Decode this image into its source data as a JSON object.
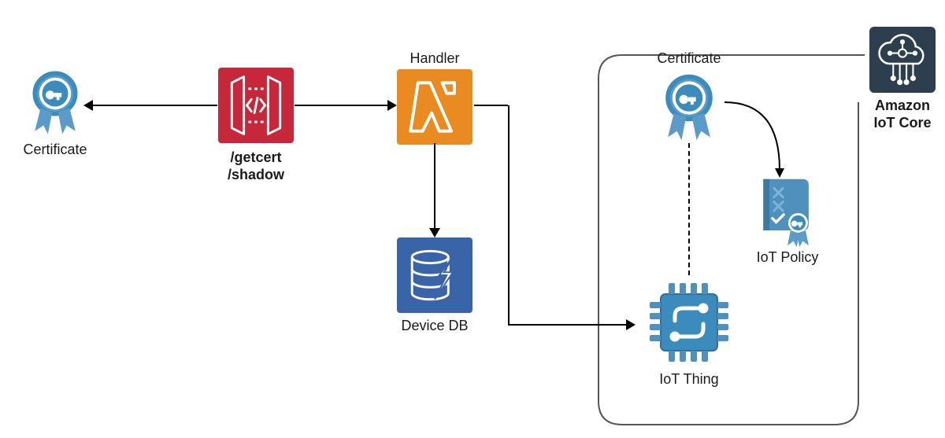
{
  "nodes": {
    "certificate_left": {
      "label": "Certificate"
    },
    "api_gateway": {
      "label_top": "/getcert",
      "label_bottom": "/shadow"
    },
    "handler": {
      "label": "Handler"
    },
    "device_db": {
      "label": "Device DB"
    },
    "certificate_iot": {
      "label": "Certificate"
    },
    "iot_policy": {
      "label": "IoT Policy"
    },
    "iot_thing": {
      "label": "IoT Thing"
    },
    "iot_core": {
      "label_line1": "Amazon",
      "label_line2": "IoT Core"
    }
  },
  "colors": {
    "blue": "#3b8bbd",
    "api_red": "#c7273a",
    "lambda_orange": "#e98b21",
    "db_blue": "#3a64a8",
    "iot_dark": "#2d3e4e"
  }
}
